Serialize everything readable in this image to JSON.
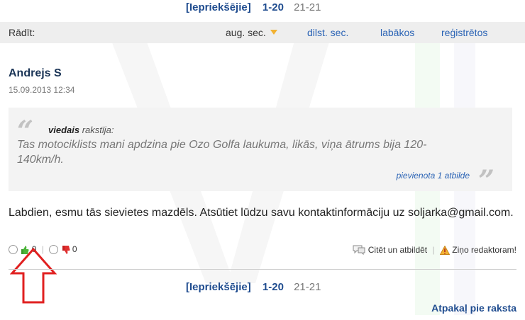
{
  "pager_top": {
    "prev": "[Iepriekšējie]",
    "current": "1-20",
    "next": "21-21"
  },
  "sort_bar": {
    "show_label": "Rādīt:",
    "options": [
      "aug. sec.",
      "dilst. sec.",
      "labākos",
      "reģistrētos"
    ],
    "active_index": 0
  },
  "comment": {
    "author": "Andrejs S",
    "date": "15.09.2013 12:34",
    "quote": {
      "user": "viedais",
      "verb": "rakstīja:",
      "text": "Tas motociklists mani apdzina pie Ozo Golfa laukuma, likās, viņa ātrums bija 120-140km/h.",
      "attachment": "pievienota 1 atbilde"
    },
    "text": "Labdien, esmu tās sievietes mazdēls. Atsūtiet lūdzu savu kontaktinformāciju uz soljarka@gmail.com.",
    "votes": {
      "up": "0",
      "down": "0"
    },
    "actions": {
      "reply": "Citēt un atbildēt",
      "report": "Ziņo redaktoram!"
    }
  },
  "pager_bottom": {
    "prev": "[Iepriekšējie]",
    "current": "1-20",
    "next": "21-21"
  },
  "back_link": "Atpakaļ pie raksta",
  "colors": {
    "link": "#2a63b5",
    "annotation_arrow": "#e02020",
    "accent": "#f2b232"
  },
  "icons": [
    "dropdown-triangle-icon",
    "quote-open-icon",
    "quote-close-icon",
    "thumb-up-icon",
    "thumb-down-icon",
    "speech-bubble-icon",
    "warning-icon",
    "red-arrow-annotation"
  ]
}
